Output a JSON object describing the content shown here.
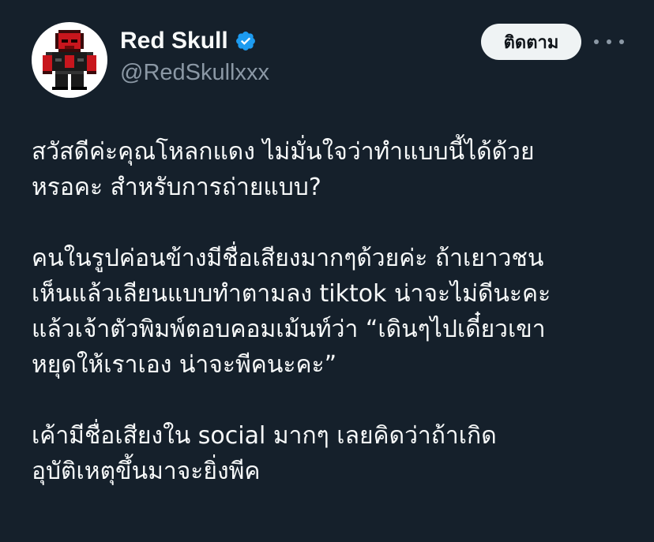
{
  "author": {
    "display_name": "Red Skull",
    "handle": "@RedSkullxxx",
    "verified": true,
    "avatar_icon": "red-skull-pixel-avatar"
  },
  "actions": {
    "follow_label": "ติดตาม",
    "more_icon": "more-horizontal-icon"
  },
  "colors": {
    "background": "#15202b",
    "text": "#f7f9f9",
    "secondary_text": "#8b98a5",
    "verified_blue": "#1d9bf0",
    "follow_bg": "#eff3f4"
  },
  "tweet": {
    "paragraphs": [
      {
        "lines": [
          "สวัสดีค่ะคุณโหลกแดง ไม่มั่นใจว่าทำแบบนี้ได้ด้วย",
          "หรอคะ สำหรับการถ่ายแบบ?"
        ]
      },
      {
        "lines": [
          "คนในรูปค่อนข้างมีชื่อเสียงมากๆด้วยค่ะ ถ้าเยาวชน",
          "เห็นแล้วเลียนแบบทำตามลง tiktok น่าจะไม่ดีนะคะ",
          "แล้วเจ้าตัวพิมพ์ตอบคอมเม้นท์ว่า “เดินๆไปเดี๋ยวเขา",
          "หยุดให้เราเอง น่าจะพีคนะคะ”"
        ]
      },
      {
        "lines": [
          "เค้ามีชื่อเสียงใน social มากๆ เลยคิดว่าถ้าเกิด",
          "อุบัติเหตุขึ้นมาจะยิ่งพีค"
        ]
      }
    ]
  }
}
